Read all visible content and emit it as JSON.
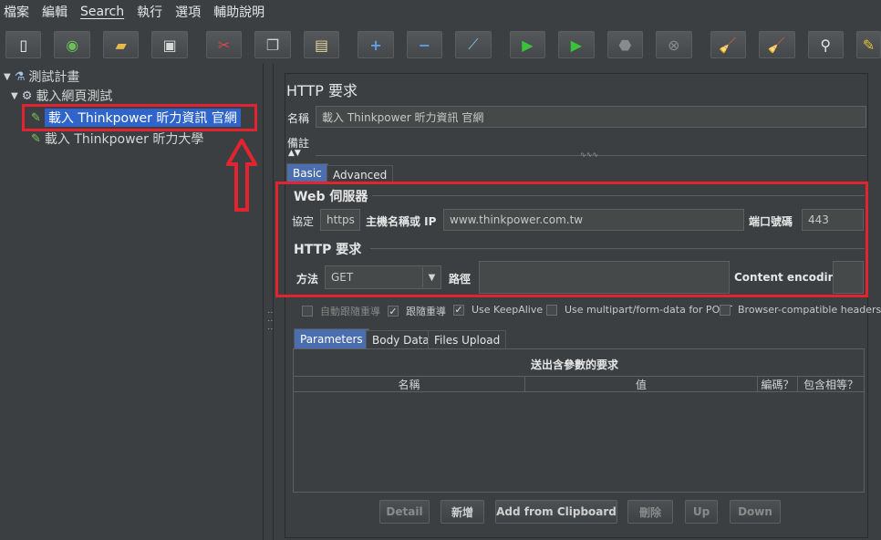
{
  "menu": [
    "檔案",
    "編輯",
    "Search",
    "執行",
    "選項",
    "輔助說明"
  ],
  "toolbar": [
    "new-icon",
    "templates-icon",
    "open-icon",
    "save-icon",
    "cut-icon",
    "copy-icon",
    "paste-icon",
    "expand-icon",
    "collapse-icon",
    "toggle-icon",
    "start-icon",
    "start-no-pause-icon",
    "stop-icon",
    "shutdown-icon",
    "clear-icon",
    "clear-all-icon",
    "search-icon",
    "reset-search-icon"
  ],
  "tree": {
    "plan": "測試計畫",
    "group": "載入網頁測試",
    "item1": "載入 Thinkpower 昕力資訊 官網",
    "item2": "載入 Thinkpower 昕力大學"
  },
  "panel": {
    "title": "HTTP 要求",
    "name_label": "名稱",
    "name_value": "載入 Thinkpower 昕力資訊 官網",
    "comment_label": "備註",
    "tabs": [
      "Basic",
      "Advanced"
    ],
    "web_server_title": "Web 伺服器",
    "protocol_label": "協定",
    "protocol_value": "https",
    "host_label": "主機名稱或 IP",
    "host_value": "www.thinkpower.com.tw",
    "port_label": "端口號碼",
    "port_value": "443",
    "http_title": "HTTP 要求",
    "method_label": "方法",
    "method_value": "GET",
    "path_label": "路徑",
    "path_value": "",
    "encoding_label": "Content encoding:",
    "checkboxes": [
      {
        "label": "自動跟隨重導",
        "checked": false
      },
      {
        "label": "跟隨重導",
        "checked": true
      },
      {
        "label": "Use KeepAlive",
        "checked": true
      },
      {
        "label": "Use multipart/form-data for POST",
        "checked": false
      },
      {
        "label": "Browser-compatible headers",
        "checked": false
      }
    ],
    "param_tabs": [
      "Parameters",
      "Body Data",
      "Files Upload"
    ],
    "table_title": "送出含參數的要求",
    "columns": [
      "名稱",
      "值",
      "編碼？",
      "包含相等？"
    ],
    "buttons": [
      "Detail",
      "新增",
      "Add from Clipboard",
      "刪除",
      "Up",
      "Down"
    ]
  },
  "colors": {
    "highlight": "#e32430",
    "selection": "#2f65ca"
  }
}
